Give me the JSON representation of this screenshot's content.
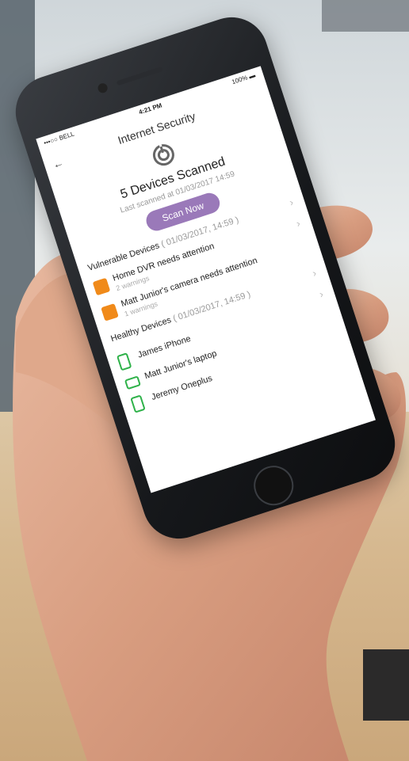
{
  "status": {
    "carrier": "•••○○ BELL",
    "time": "4:21 PM",
    "battery": "100%"
  },
  "header": {
    "title": "Internet Security",
    "back_icon": "arrow-left-icon"
  },
  "scan": {
    "count_label": "5 Devices Scanned",
    "last_scanned": "Last scanned at 01/03/2017 14:59",
    "button_label": "Scan Now",
    "button_color": "#9a79b9"
  },
  "vulnerable": {
    "heading": "Vulnerable Devices",
    "date": "( 01/03/2017, 14:59 )",
    "items": [
      {
        "title": "Home DVR needs attention",
        "sub": "2 warnings",
        "icon": "dvr-icon"
      },
      {
        "title": "Matt Junior's camera needs attention",
        "sub": "1 warnings",
        "icon": "camera-icon"
      }
    ]
  },
  "healthy": {
    "heading": "Healthy Devices",
    "date": "( 01/03/2017, 14:59 )",
    "items": [
      {
        "title": "James iPhone",
        "icon": "phone-icon"
      },
      {
        "title": "Matt Junior's laptop",
        "icon": "laptop-icon"
      },
      {
        "title": "Jeremy Oneplus",
        "icon": "phone-icon"
      }
    ]
  },
  "colors": {
    "warning": "#f08a1a",
    "healthy": "#2fb24a",
    "accent": "#9a79b9"
  }
}
